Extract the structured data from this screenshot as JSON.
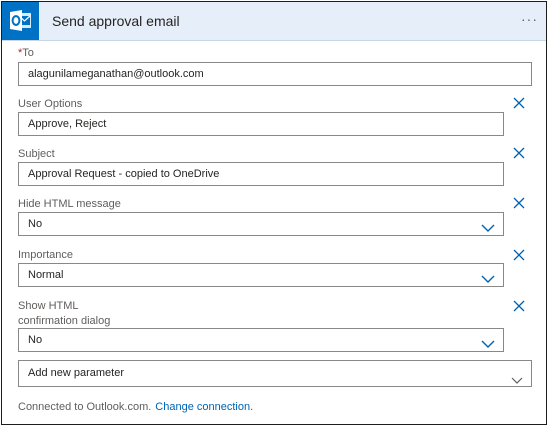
{
  "header": {
    "title": "Send approval email",
    "menu_icon": "ellipsis-icon"
  },
  "fields": {
    "to": {
      "required_mark": "*",
      "label": "To",
      "value": "alagunilameganathan@outlook.com"
    },
    "user_options": {
      "label": "User Options",
      "value": "Approve, Reject"
    },
    "subject": {
      "label": "Subject",
      "value": "Approval Request - copied to OneDrive"
    },
    "hide_html": {
      "label": "Hide HTML message",
      "value": "No"
    },
    "importance": {
      "label": "Importance",
      "value": "Normal"
    },
    "show_html": {
      "label_line1": "Show HTML",
      "label_line2": "confirmation dialog",
      "value": "No"
    }
  },
  "add_parameter": {
    "placeholder": "Add new parameter"
  },
  "footer": {
    "connected_text": "Connected to Outlook.com.",
    "change_link": "Change connection."
  },
  "colors": {
    "accent": "#0072c6",
    "header_bg": "#e6eff9",
    "link": "#0063b1"
  }
}
